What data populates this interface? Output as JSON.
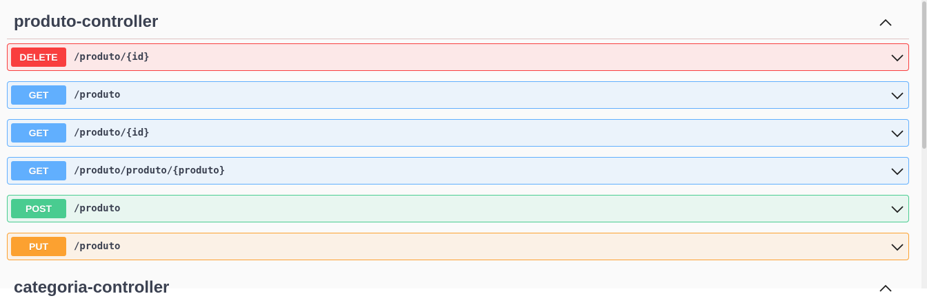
{
  "sections": [
    {
      "title": "produto-controller",
      "operations": [
        {
          "method": "DELETE",
          "path": "/produto/{id}"
        },
        {
          "method": "GET",
          "path": "/produto"
        },
        {
          "method": "GET",
          "path": "/produto/{id}"
        },
        {
          "method": "GET",
          "path": "/produto/produto/{produto}"
        },
        {
          "method": "POST",
          "path": "/produto"
        },
        {
          "method": "PUT",
          "path": "/produto"
        }
      ]
    },
    {
      "title": "categoria-controller"
    }
  ],
  "icons": {
    "section_toggle": "chevron-up-icon",
    "operation_expand": "chevron-down-icon"
  },
  "colors": {
    "delete": "#f93e3e",
    "get": "#61affe",
    "post": "#49cc90",
    "put": "#fca130",
    "title_text": "#3b4151"
  }
}
